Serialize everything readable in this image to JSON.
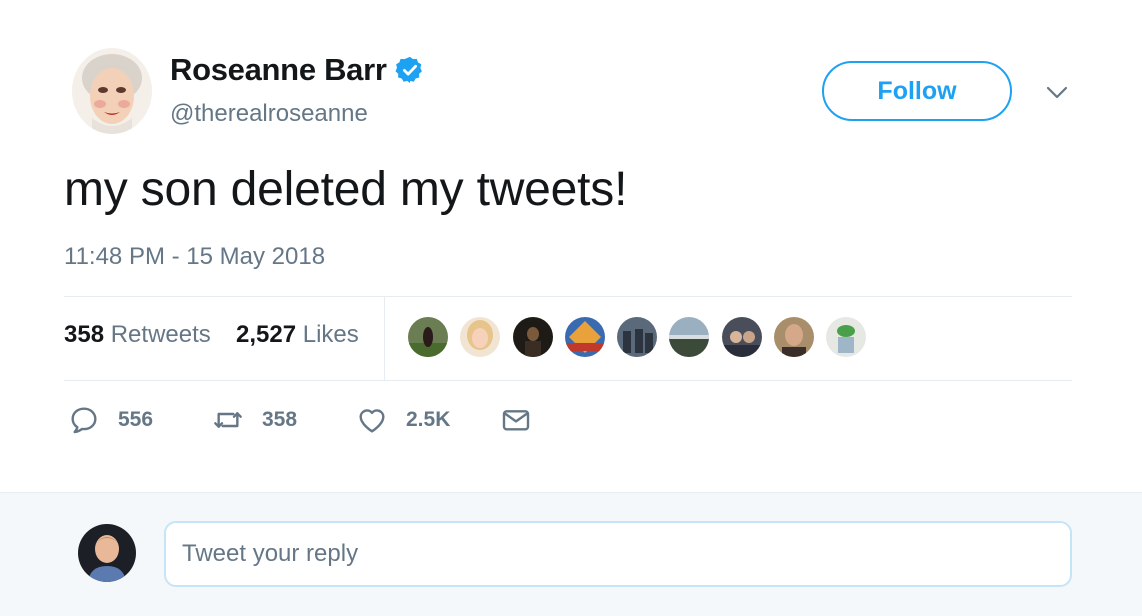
{
  "author": {
    "name": "Roseanne Barr",
    "handle": "@therealroseanne",
    "verified": true
  },
  "follow_label": "Follow",
  "tweet": {
    "text": "my son deleted my tweets!",
    "timestamp": "11:48 PM - 15 May 2018"
  },
  "stats": {
    "retweets_count": "358",
    "retweets_label": "Retweets",
    "likes_count": "2,527",
    "likes_label": "Likes"
  },
  "likers": [
    "liker-avatar-1",
    "liker-avatar-2",
    "liker-avatar-3",
    "liker-avatar-4",
    "liker-avatar-5",
    "liker-avatar-6",
    "liker-avatar-7",
    "liker-avatar-8",
    "liker-avatar-9"
  ],
  "actions": {
    "reply_count": "556",
    "retweet_count": "358",
    "like_count": "2.5K"
  },
  "reply": {
    "placeholder": "Tweet your reply"
  },
  "colors": {
    "accent": "#1da1f2",
    "secondary_text": "#657786",
    "primary_text": "#14171a",
    "divider": "#e6ecf0",
    "reply_bg": "#f5f8fa"
  },
  "icons": {
    "verified": "verified-badge-icon",
    "caret": "chevron-down-icon",
    "reply": "reply-bubble-icon",
    "retweet": "retweet-icon",
    "like": "heart-icon",
    "dm": "envelope-icon"
  }
}
